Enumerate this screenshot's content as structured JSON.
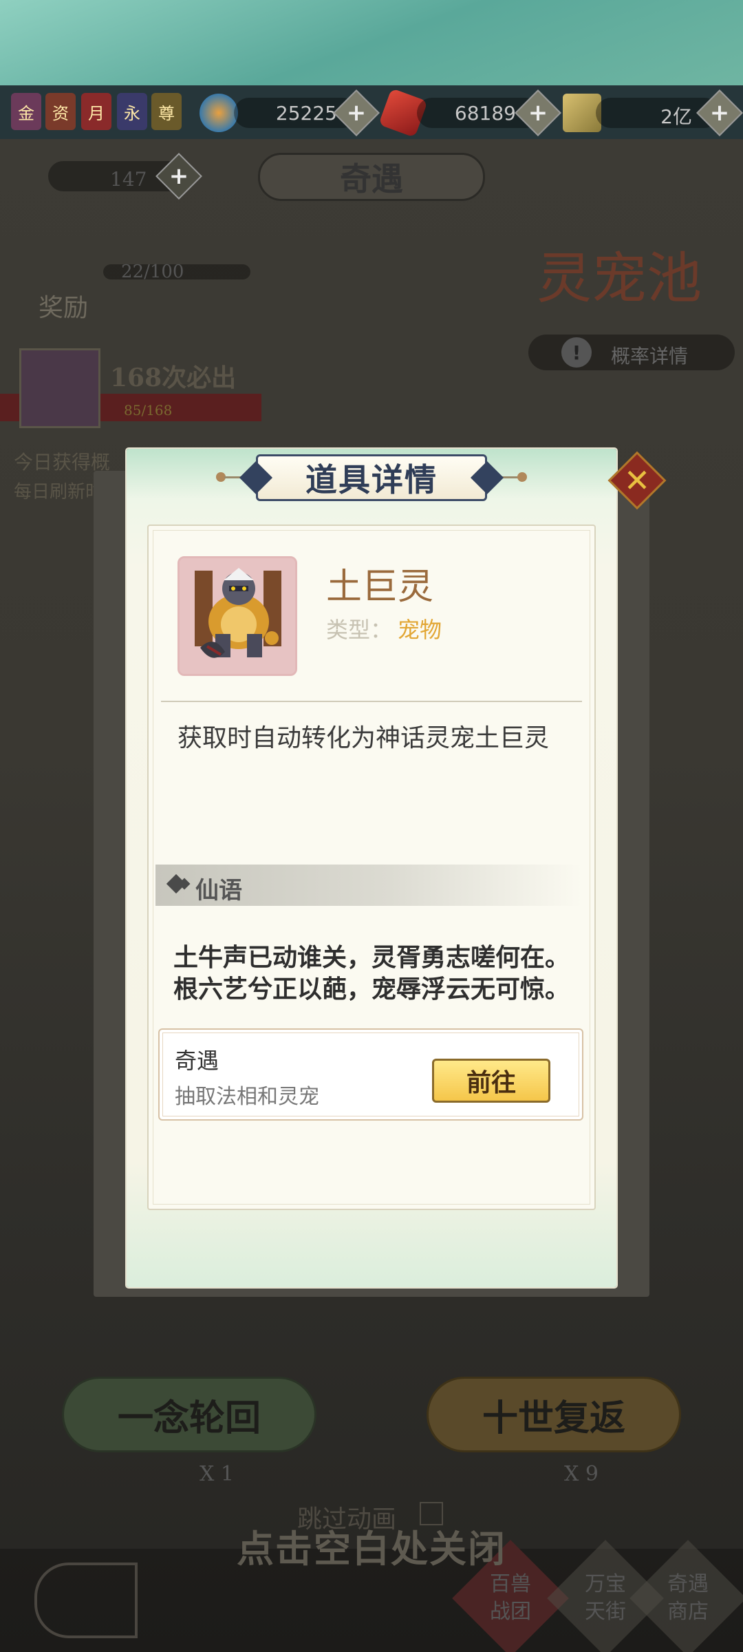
{
  "resources": {
    "badges": [
      "金",
      "资",
      "月",
      "永",
      "尊"
    ],
    "stone": "25225",
    "red_gem": "68189",
    "scroll": "2亿"
  },
  "background": {
    "ticket_count": "147",
    "page_title": "奇遇",
    "progress": "22/100",
    "reward_label": "奖励",
    "pool_title": "灵宠池",
    "prob_details": "概率详情",
    "guarantee": "168次必出",
    "guarantee_progress": "85/168",
    "today_line1": "今日获得概",
    "today_line2": "每日刷新时",
    "btn_single": "一念轮回",
    "btn_ten": "十世复返",
    "cost_single": "X 1",
    "cost_ten": "X 9",
    "skip_animation": "跳过动画",
    "close_hint": "点击空白处关闭",
    "nav_items": [
      "百兽\n战团",
      "万宝\n天街",
      "奇遇\n商店"
    ]
  },
  "modal": {
    "title": "道具详情",
    "item_name": "土巨灵",
    "type_label": "类型：",
    "type_value": "宠物",
    "description": "获取时自动转化为神话灵宠土巨灵",
    "section_title": "仙语",
    "poem_line1": "土牛声已动谁关，灵胥勇志嗟何在。",
    "poem_line2": "根六艺兮正以葩，宠辱浮云无可惊。",
    "source_title": "奇遇",
    "source_subtitle": "抽取法相和灵宠",
    "go_button": "前往",
    "close_symbol": "✕"
  },
  "colors": {
    "name_brown": "#9a6a3c",
    "type_orange": "#e2a634",
    "go_yellow": "#f5c64a",
    "header_navy": "#2f3d57"
  }
}
